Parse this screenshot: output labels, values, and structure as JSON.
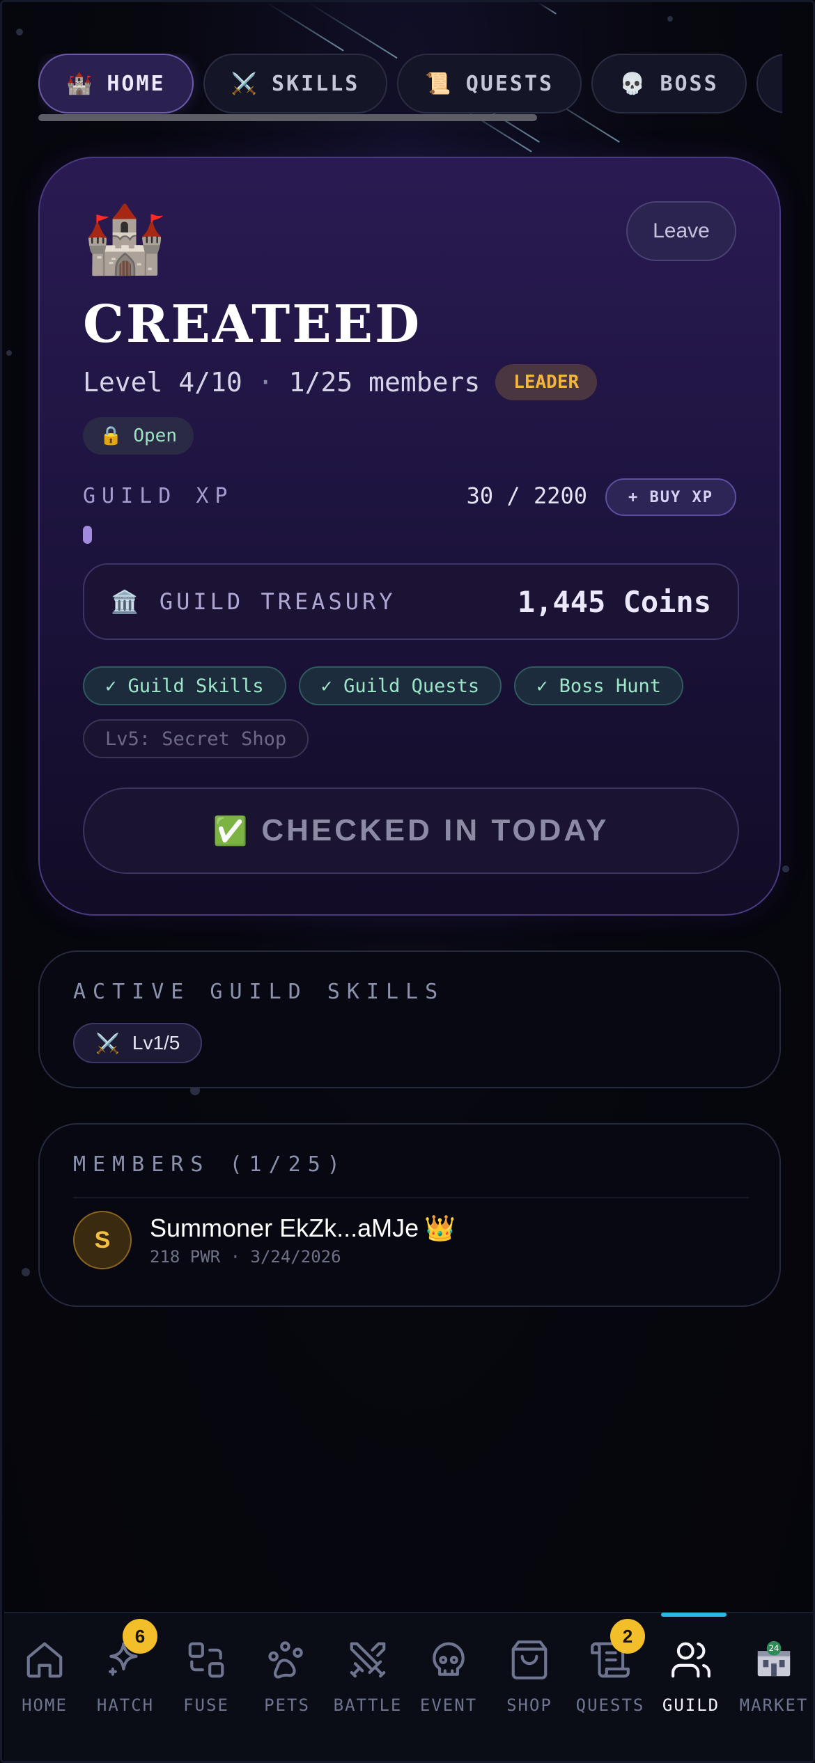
{
  "tabs": [
    {
      "label": "HOME",
      "icon": "🏰",
      "active": true
    },
    {
      "label": "SKILLS",
      "icon": "⚔️"
    },
    {
      "label": "QUESTS",
      "icon": "📜"
    },
    {
      "label": "BOSS",
      "icon": "💀"
    },
    {
      "label": "",
      "icon": "🛒"
    }
  ],
  "guild": {
    "emblem": "🏰",
    "name": "CREATEED",
    "leave_label": "Leave",
    "level": "Level 4/10",
    "separator": "·",
    "members": "1/25 members",
    "role_badge": "LEADER",
    "status_icon": "🔒",
    "status": "Open",
    "xp_label": "GUILD XP",
    "xp_value": "30 / 2200",
    "xp_fraction": 0.0136,
    "buy_xp_label": "+ BUY XP",
    "treasury_icon": "🏛️",
    "treasury_label": "GUILD TREASURY",
    "treasury_value": "1,445 Coins",
    "features": [
      {
        "label": "✓ Guild Skills",
        "unlocked": true
      },
      {
        "label": "✓ Guild Quests",
        "unlocked": true
      },
      {
        "label": "✓ Boss Hunt",
        "unlocked": true
      },
      {
        "label": "Lv5: Secret Shop",
        "unlocked": false
      }
    ],
    "checkin_icon": "✅",
    "checkin_label": "CHECKED IN TODAY"
  },
  "skills": {
    "title": "ACTIVE GUILD SKILLS",
    "chip_icon": "⚔️",
    "chip_label": "Lv1/5"
  },
  "members": {
    "title": "MEMBERS (1/25)",
    "list": [
      {
        "initial": "S",
        "name": "Summoner EkZk...aMJe",
        "crown": "👑",
        "meta": "218 PWR · 3/24/2026"
      }
    ]
  },
  "bottom_nav": [
    {
      "label": "HOME",
      "icon": "home-icon"
    },
    {
      "label": "HATCH",
      "icon": "sparkle-icon",
      "badge": "6"
    },
    {
      "label": "FUSE",
      "icon": "fuse-icon"
    },
    {
      "label": "PETS",
      "icon": "paw-icon"
    },
    {
      "label": "BATTLE",
      "icon": "swords-icon"
    },
    {
      "label": "EVENT",
      "icon": "skull-icon"
    },
    {
      "label": "SHOP",
      "icon": "bag-icon"
    },
    {
      "label": "QUESTS",
      "icon": "scroll-icon",
      "badge": "2"
    },
    {
      "label": "GUILD",
      "icon": "users-icon",
      "active": true
    },
    {
      "label": "MARKET",
      "icon": "market-icon"
    }
  ],
  "colors": {
    "accent": "#29b7e4",
    "badge": "#f2bf2a",
    "leader": "#f2b63c",
    "unlocked": "#9ee6c8"
  }
}
